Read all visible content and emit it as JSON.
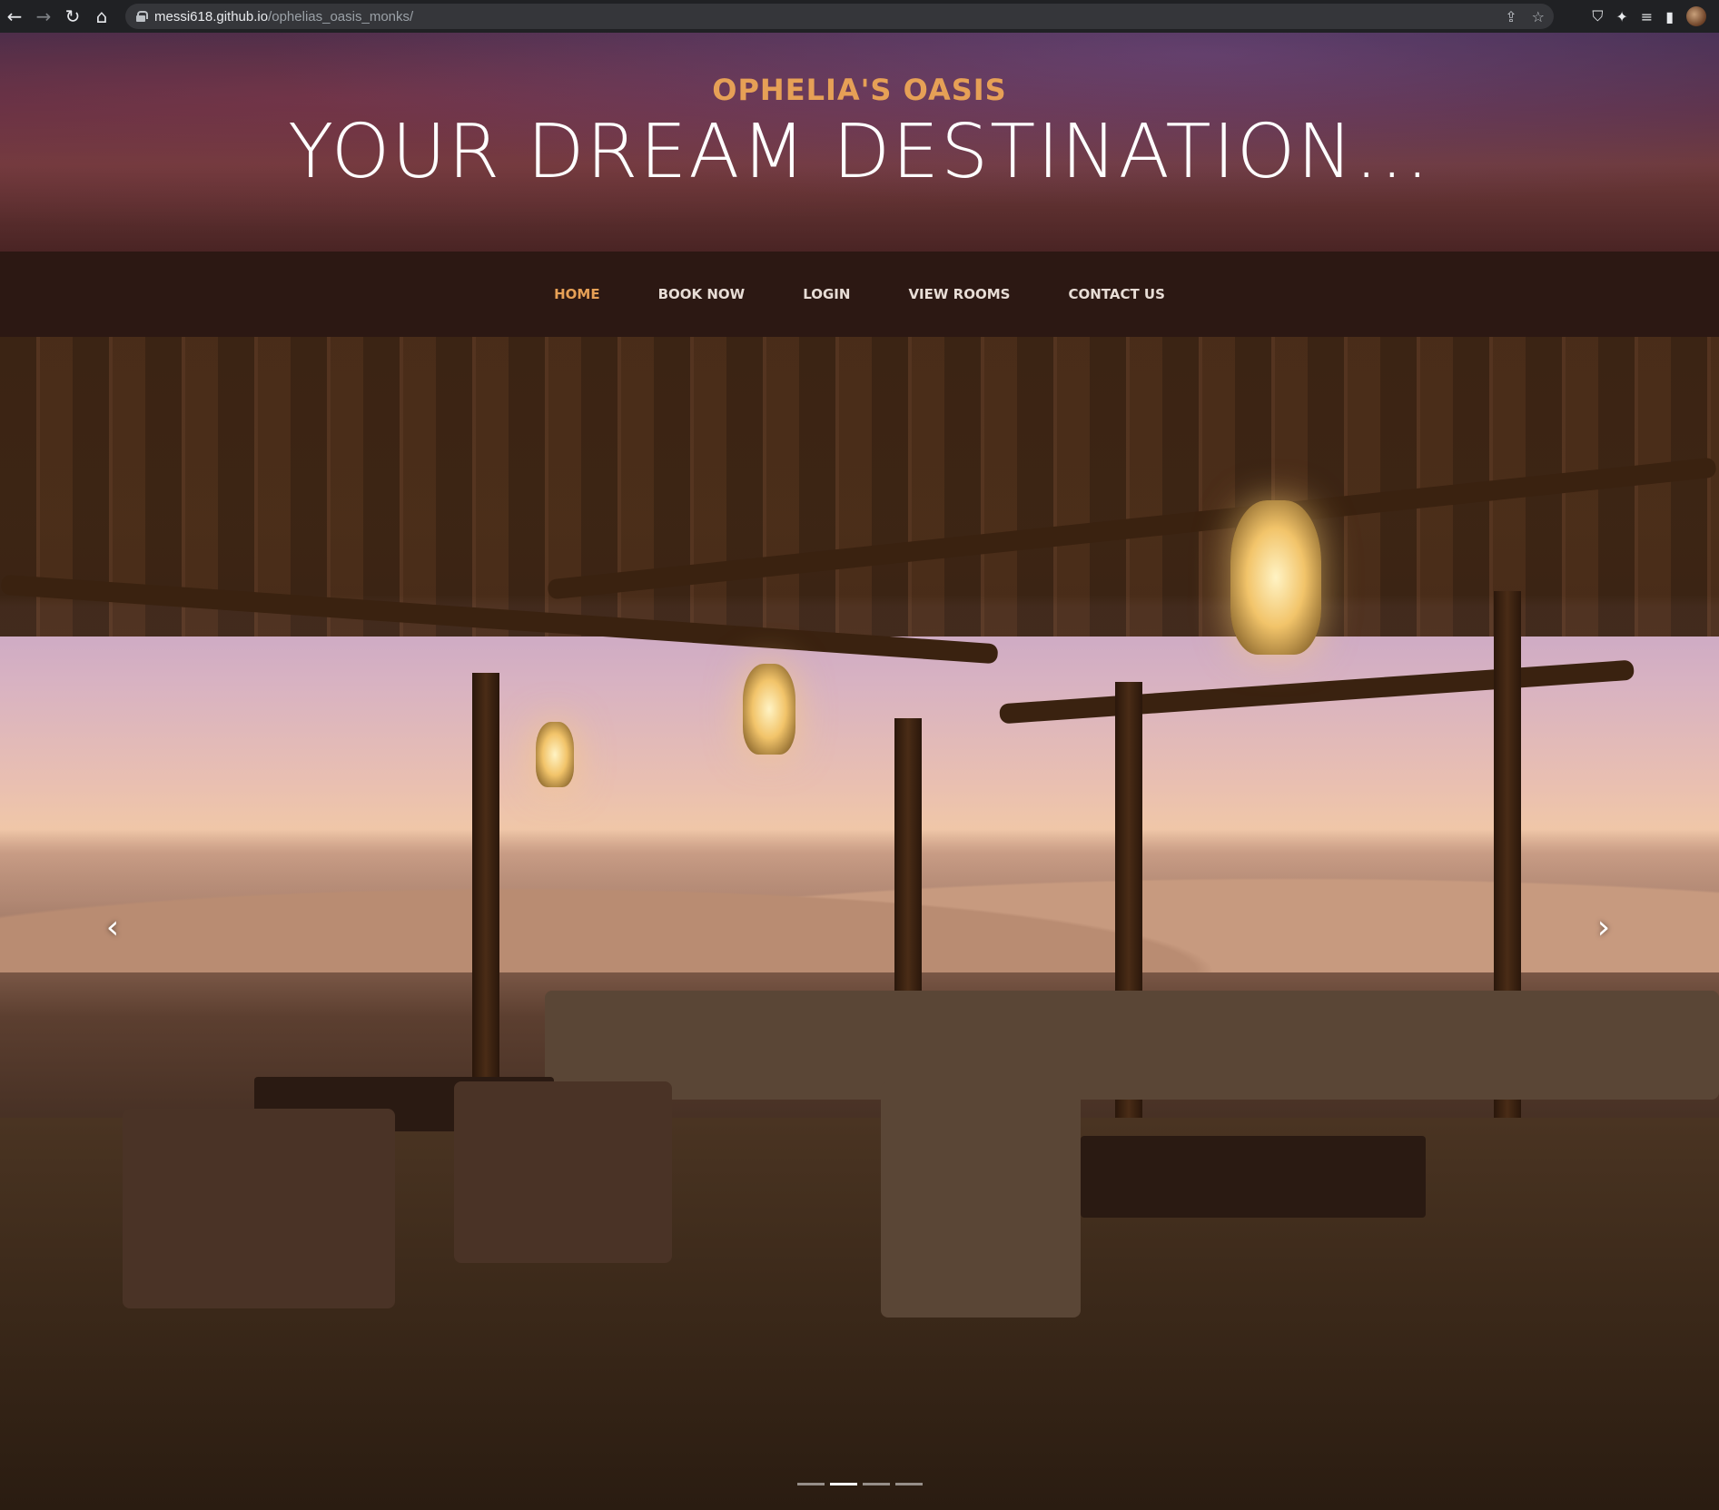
{
  "browser": {
    "url_host": "messi618.github.io",
    "url_path": "/ophelias_oasis_monks/"
  },
  "header": {
    "brand": "OPHELIA'S OASIS",
    "tagline": "YOUR DREAM DESTINATION..."
  },
  "nav": {
    "items": [
      {
        "label": "HOME",
        "active": true
      },
      {
        "label": "BOOK NOW",
        "active": false
      },
      {
        "label": "LOGIN",
        "active": false
      },
      {
        "label": "VIEW ROOMS",
        "active": false
      },
      {
        "label": "CONTACT US",
        "active": false
      }
    ]
  },
  "carousel": {
    "prev_icon": "chevron-left-icon",
    "next_icon": "chevron-right-icon",
    "slide_count": 4,
    "active_slide": 2
  },
  "colors": {
    "accent": "#e6a056",
    "navbar_bg": "#2c1813",
    "nav_text": "#e8ddd6"
  }
}
